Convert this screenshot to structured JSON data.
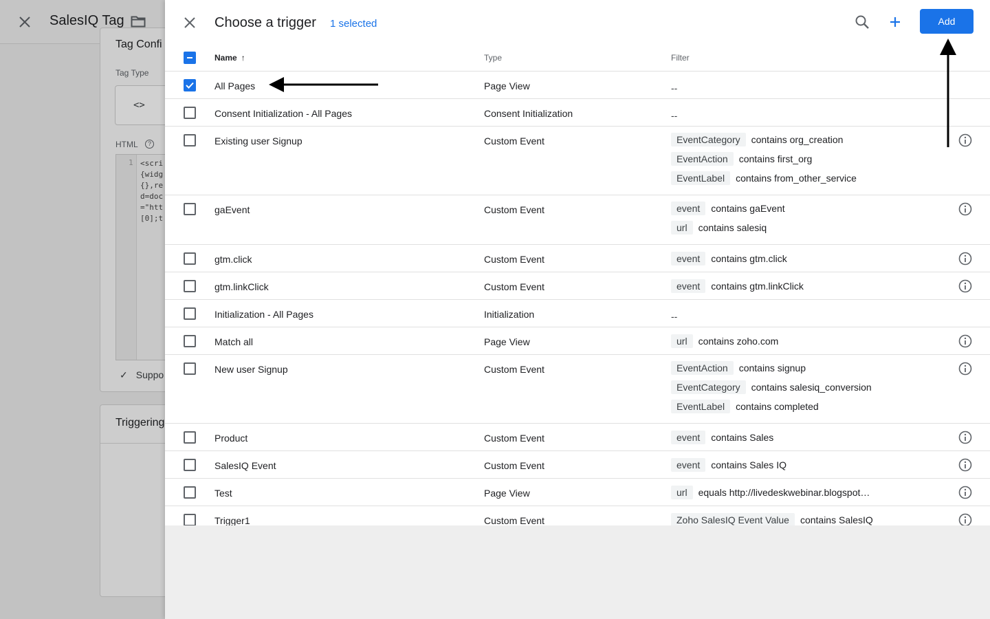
{
  "background": {
    "title": "SalesIQ Tag",
    "card_title": "Tag Confi",
    "tag_type_label": "Tag Type",
    "html_label": "HTML",
    "code_line_number": "1",
    "code_preview": "<scri\n{widg\n{},re\nd=doc\n=\"htt\n[0];t",
    "support_text": "Suppo",
    "triggering_title": "Triggering"
  },
  "panel": {
    "title": "Choose a trigger",
    "selected_label": "1 selected",
    "add_label": "Add",
    "columns": {
      "name": "Name",
      "type": "Type",
      "filter": "Filter"
    },
    "dash": "--",
    "rows": [
      {
        "name": "All Pages",
        "type": "Page View",
        "checked": true,
        "filters": []
      },
      {
        "name": "Consent Initialization - All Pages",
        "type": "Consent Initialization",
        "checked": false,
        "filters": []
      },
      {
        "name": "Existing user Signup",
        "type": "Custom Event",
        "checked": false,
        "filters": [
          {
            "chip": "EventCategory",
            "cond": "contains org_creation"
          },
          {
            "chip": "EventAction",
            "cond": "contains first_org"
          },
          {
            "chip": "EventLabel",
            "cond": "contains from_other_service"
          }
        ]
      },
      {
        "name": "gaEvent",
        "type": "Custom Event",
        "checked": false,
        "filters": [
          {
            "chip": "event",
            "cond": "contains gaEvent"
          },
          {
            "chip": "url",
            "cond": "contains salesiq"
          }
        ]
      },
      {
        "name": "gtm.click",
        "type": "Custom Event",
        "checked": false,
        "filters": [
          {
            "chip": "event",
            "cond": "contains gtm.click"
          }
        ]
      },
      {
        "name": "gtm.linkClick",
        "type": "Custom Event",
        "checked": false,
        "filters": [
          {
            "chip": "event",
            "cond": "contains gtm.linkClick"
          }
        ]
      },
      {
        "name": "Initialization - All Pages",
        "type": "Initialization",
        "checked": false,
        "filters": []
      },
      {
        "name": "Match all",
        "type": "Page View",
        "checked": false,
        "filters": [
          {
            "chip": "url",
            "cond": "contains zoho.com"
          }
        ]
      },
      {
        "name": "New user Signup",
        "type": "Custom Event",
        "checked": false,
        "filters": [
          {
            "chip": "EventAction",
            "cond": "contains signup"
          },
          {
            "chip": "EventCategory",
            "cond": "contains salesiq_conversion"
          },
          {
            "chip": "EventLabel",
            "cond": "contains completed"
          }
        ]
      },
      {
        "name": "Product",
        "type": "Custom Event",
        "checked": false,
        "filters": [
          {
            "chip": "event",
            "cond": "contains Sales"
          }
        ]
      },
      {
        "name": "SalesIQ Event",
        "type": "Custom Event",
        "checked": false,
        "filters": [
          {
            "chip": "event",
            "cond": "contains Sales IQ"
          }
        ]
      },
      {
        "name": "Test",
        "type": "Page View",
        "checked": false,
        "filters": [
          {
            "chip": "url",
            "cond": "equals http://livedeskwebinar.blogspot…"
          }
        ]
      },
      {
        "name": "Trigger1",
        "type": "Custom Event",
        "checked": false,
        "filters": [
          {
            "chip": "Zoho SalesIQ Event Value",
            "cond": "contains SalesIQ"
          }
        ]
      }
    ]
  },
  "colors": {
    "accent": "#1a73e8",
    "chip_bg": "#f1f3f4",
    "divider": "#e0e0e0"
  },
  "icons": {
    "close": "close-icon",
    "search": "search-icon",
    "add": "plus-icon",
    "info": "info-icon",
    "sort": "arrow-up-icon",
    "folder": "folder-icon"
  }
}
